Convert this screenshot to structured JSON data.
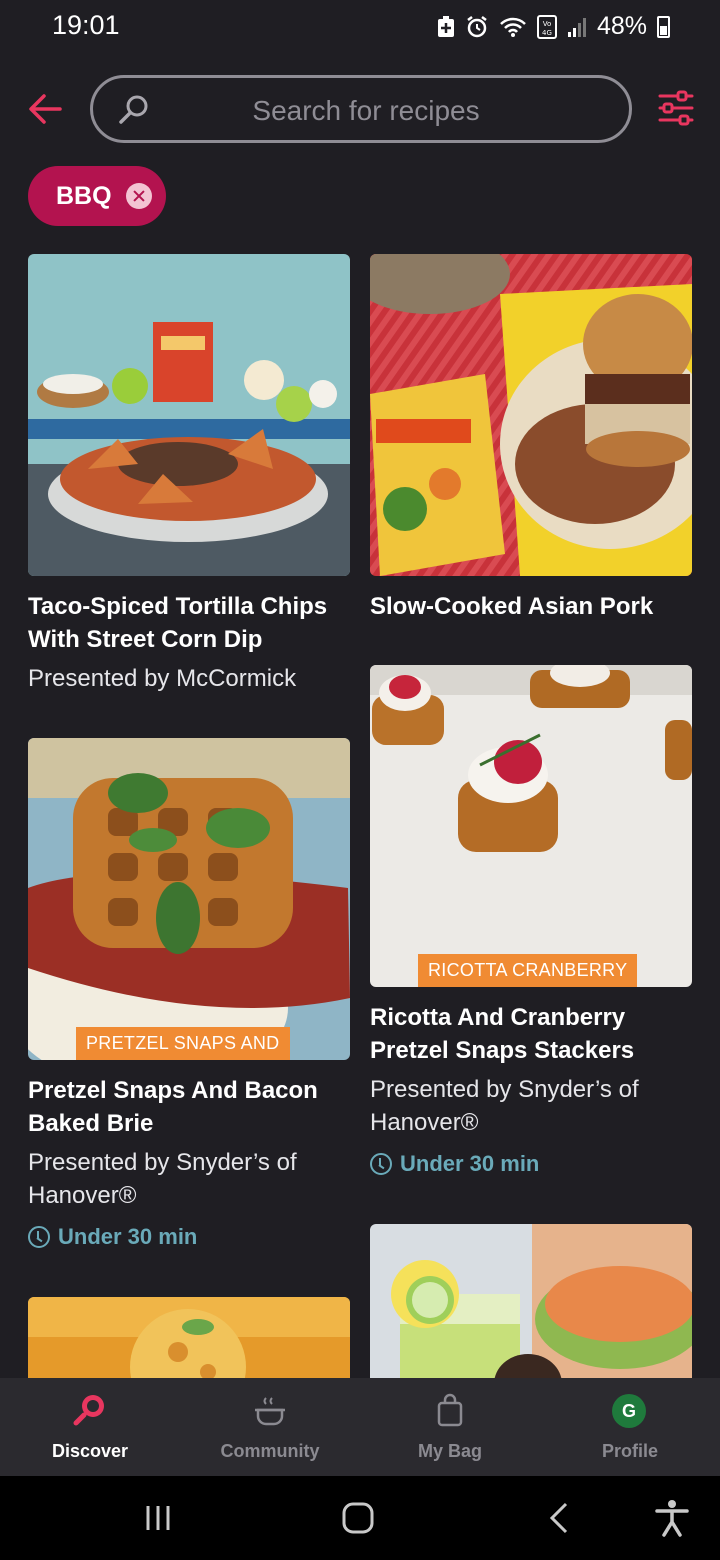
{
  "status_bar": {
    "time": "19:01",
    "battery": "48%",
    "icons": [
      "battery-saver-icon",
      "alarm-icon",
      "wifi-icon",
      "volte-4g-icon",
      "signal-icon"
    ]
  },
  "search": {
    "placeholder": "Search for recipes"
  },
  "filter_chip": {
    "label": "BBQ"
  },
  "colors": {
    "accent": "#e8365f",
    "chip_bg": "#b3134f",
    "time_text": "#6aaab9",
    "badge_bg": "#f08b33",
    "background": "#1f1e23"
  },
  "recipes": [
    {
      "title": "Taco-Spiced Tortilla Chips With Street Corn Dip",
      "sponsor": "Presented by McCormick",
      "time": "",
      "badge": "",
      "image": "taco-chips-photo"
    },
    {
      "title": "Slow-Cooked Asian Pork",
      "sponsor": "",
      "time": "",
      "badge": "",
      "image": "asian-pork-sandwich-photo"
    },
    {
      "title": "Pretzel Snaps And Bacon Baked Brie",
      "sponsor": "Presented by Snyder’s of Hanover®",
      "time": "Under 30 min",
      "badge": "PRETZEL SNAPS AND",
      "image": "pretzel-bacon-brie-photo"
    },
    {
      "title": "Ricotta And Cranberry Pretzel Snaps Stackers",
      "sponsor": "Presented by Snyder’s of Hanover®",
      "time": "Under 30 min",
      "badge": "RICOTTA CRANBERRY",
      "image": "ricotta-cranberry-stackers-photo"
    },
    {
      "title": "",
      "sponsor": "",
      "time": "",
      "badge": "",
      "image": "fried-bite-photo"
    },
    {
      "title": "",
      "sponsor": "",
      "time": "",
      "badge": "",
      "image": "lemonade-dip-photo"
    }
  ],
  "bottom_nav": [
    {
      "label": "Discover",
      "icon": "search-lens-icon",
      "active": true
    },
    {
      "label": "Community",
      "icon": "pot-icon",
      "active": false
    },
    {
      "label": "My Bag",
      "icon": "bag-icon",
      "active": false
    },
    {
      "label": "Profile",
      "icon": "avatar",
      "avatar_letter": "G",
      "active": false
    }
  ]
}
